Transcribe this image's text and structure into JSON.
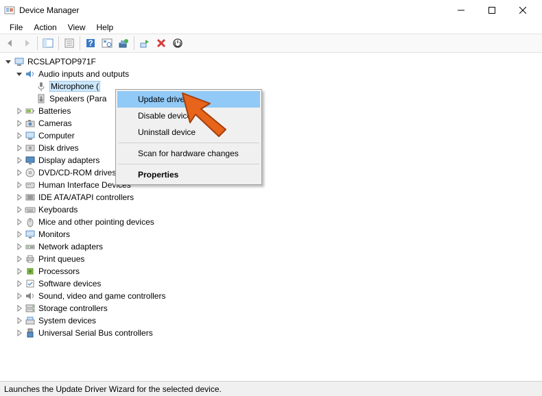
{
  "window": {
    "title": "Device Manager"
  },
  "menubar": {
    "file": "File",
    "action": "Action",
    "view": "View",
    "help": "Help"
  },
  "tree": {
    "root": "RCSLAPTOP971F",
    "audio_category": "Audio inputs and outputs",
    "audio_children": {
      "microphone": "Microphone (",
      "speakers": "Speakers (Para"
    },
    "categories": [
      "Batteries",
      "Cameras",
      "Computer",
      "Disk drives",
      "Display adapters",
      "DVD/CD-ROM drives",
      "Human Interface Devices",
      "IDE ATA/ATAPI controllers",
      "Keyboards",
      "Mice and other pointing devices",
      "Monitors",
      "Network adapters",
      "Print queues",
      "Processors",
      "Software devices",
      "Sound, video and game controllers",
      "Storage controllers",
      "System devices",
      "Universal Serial Bus controllers"
    ]
  },
  "context_menu": {
    "update_driver": "Update driver",
    "disable_device": "Disable device",
    "uninstall_device": "Uninstall device",
    "scan": "Scan for hardware changes",
    "properties": "Properties"
  },
  "statusbar": {
    "text": "Launches the Update Driver Wizard for the selected device."
  },
  "category_icons": {
    "Batteries": "battery",
    "Cameras": "camera",
    "Computer": "computer",
    "Disk drives": "disk",
    "Display adapters": "display",
    "DVD/CD-ROM drives": "dvd",
    "Human Interface Devices": "hid",
    "IDE ATA/ATAPI controllers": "ide",
    "Keyboards": "keyboard",
    "Mice and other pointing devices": "mouse",
    "Monitors": "monitor",
    "Network adapters": "network",
    "Print queues": "printer",
    "Processors": "cpu",
    "Software devices": "software",
    "Sound, video and game controllers": "sound",
    "Storage controllers": "storage",
    "System devices": "system",
    "Universal Serial Bus controllers": "usb"
  }
}
